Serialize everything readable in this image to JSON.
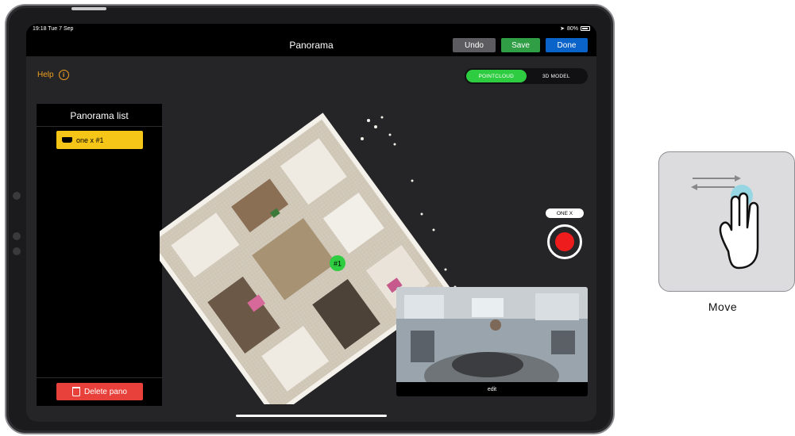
{
  "status_bar": {
    "time": "19:18",
    "date": "Tue 7 Sep",
    "battery": "80%"
  },
  "nav": {
    "title": "Panorama",
    "undo_label": "Undo",
    "save_label": "Save",
    "done_label": "Done"
  },
  "help": {
    "label": "Help",
    "icon": "info-icon"
  },
  "view_toggle": {
    "options": [
      "POINTCLOUD",
      "3D MODEL"
    ],
    "selected": "POINTCLOUD"
  },
  "panorama_list": {
    "title": "Panorama list",
    "items": [
      {
        "label": "one x #1",
        "icon": "camera-icon"
      }
    ],
    "delete_label": "Delete pano"
  },
  "pointcloud": {
    "marker_label": "#1"
  },
  "capture": {
    "device_label": "ONE X",
    "record_icon": "record-icon"
  },
  "preview": {
    "label": "edit"
  },
  "gesture": {
    "caption": "Move",
    "icon": "two-finger-drag-icon"
  },
  "colors": {
    "accent_green": "#2ecc40",
    "help_orange": "#f0a020",
    "item_yellow": "#f5c518",
    "delete_red": "#e8413b",
    "done_blue": "#0a63c8"
  }
}
